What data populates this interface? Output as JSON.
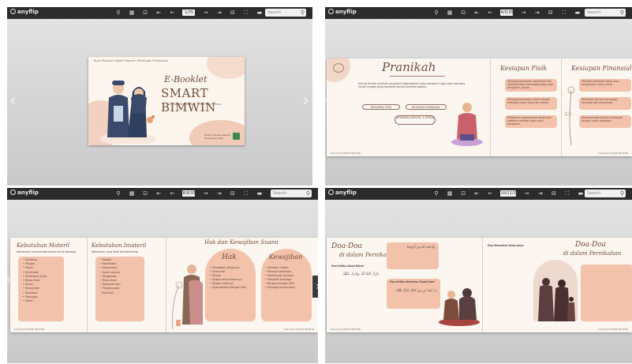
{
  "viewer": {
    "brand": "anyflip",
    "search_placeholder": "Search"
  },
  "panels": [
    {
      "page_indicator": "1/35"
    },
    {
      "page_indicator": "4/5/35"
    },
    {
      "page_indicator": "8/9/35"
    },
    {
      "page_indicator": "10/11/35"
    }
  ],
  "cover": {
    "header": "Buku Panduan Digital Program Bimbingan Perkawinan",
    "title_line1": "E-Booklet",
    "title_line2": "SMART BIMWIN",
    "subtitle": "Semoga Bermanfaat Untuk Kita Semua",
    "publisher": "Kantor Urusan Agama Bungaraya Siak"
  },
  "spread1": {
    "title": "Pranikah",
    "intro": "Hal-hal terkait pranikah yang perlu diperhatikan calon pengantin agar siap membina rumah tangga yang harmonis sesuai tuntunan agama.",
    "pills": [
      "KESIAPAN FISIK",
      "KESIAPAN FINANSIAL",
      "KESIAPAN MENTAL & SPIKIS"
    ],
    "fisik_title": "Kesiapan Fisik",
    "fisik_cards": [
      "Menjaga kesehatan reproduksi dan memeriksakan kesehatan bagi calon pengantin wanita",
      "Menjaga kesehatan tubuh dengan olahraga yang cukup dan teratur",
      "Melakukan pemeriksaan kesehatan sebelum menikah bagi calon pengantin"
    ],
    "finansial_title": "Kesiapan Finansial",
    "finansial_cards": [
      "Memiliki pekerjaan tetap atau penghasilan yang cukup",
      "Membuat rencana keuangan keluarga dan menabung",
      "Membicarakan kondisi keuangan dengan calon pasangan"
    ],
    "footer_left": "E-Booklet SMART BIMWIN",
    "footer_right": "E-Booklet SMART BIMWIN"
  },
  "spread2": {
    "materil_title": "Kebutuhan Materil",
    "materil_intro": "Kebutuhan yang bersifat benda untuk keluarga",
    "materil_items": [
      "Sandang",
      "Pangan",
      "Papan",
      "Kesehatan",
      "Pendidikan Anak",
      "Biaya Anak",
      "Sosial",
      "Kendaraan",
      "Peralatan",
      "Tabungan",
      "Zakat"
    ],
    "imateril_title": "Kebutuhan Imateril",
    "imateril_intro": "Kebutuhan yang tidak bersifat benda",
    "imateril_items": [
      "Ibadah",
      "Kesehatan",
      "Komunikasi",
      "Kasih sayang",
      "Pengertian",
      "Rasa aman",
      "Kebersamaan",
      "Penghargaan",
      "Rekreasi"
    ],
    "rights_title": "Hak dan Kewajiban Suami",
    "hak_title": "Hak",
    "hak_items": [
      "Mendapat pelayanan",
      "Dihormati",
      "Ditaati",
      "Dijaga kehormatannya",
      "Dijaga hartanya",
      "Diperlakukan dengan baik"
    ],
    "kewajiban_title": "Kewajiban",
    "kewajiban_items": [
      "Memberi nafkah",
      "Menjadi pemimpin",
      "Melindungi keluarga",
      "Mendidik keluarga",
      "Bergaul dengan baik",
      "Menjaga kehormatan"
    ],
    "footer_left": "E-Booklet SMART BIMWIN",
    "footer_right": "E-Booklet SMART BIMWIN"
  },
  "spread3": {
    "title_left_1": "Doa-Doa",
    "title_left_2": "di dalam Pernikahan",
    "title_right_1": "Doa-Doa",
    "title_right_2": "di dalam Pernikahan",
    "doa_heading_1": "Doa Ketika Akad Nikah",
    "doa_heading_2": "Doa Ketika Bertemu Suami/Istri",
    "doa_heading_3": "Doa Memohon Keturunan",
    "arabic_1": "بَارَكَ اللهُ لَكَ وَبَارَكَ عَلَيْكَ",
    "arabic_2": "رَبَّنَا هَبْ لَنَا مِنْ أَزْوَاجِنَا",
    "arabic_3": "رَبِّ هَبْ لِي مِنْ لَدُنْكَ ذُرِّيَّةً طَيِّبَةً",
    "footer_left": "E-Booklet SMART BIMWIN",
    "footer_right": "E-Booklet SMART BIMWIN"
  },
  "colors": {
    "toolbar": "#2b2b2b",
    "page": "#fbf6ef",
    "accent": "#f2c2ab",
    "text": "#6f4d3e"
  }
}
